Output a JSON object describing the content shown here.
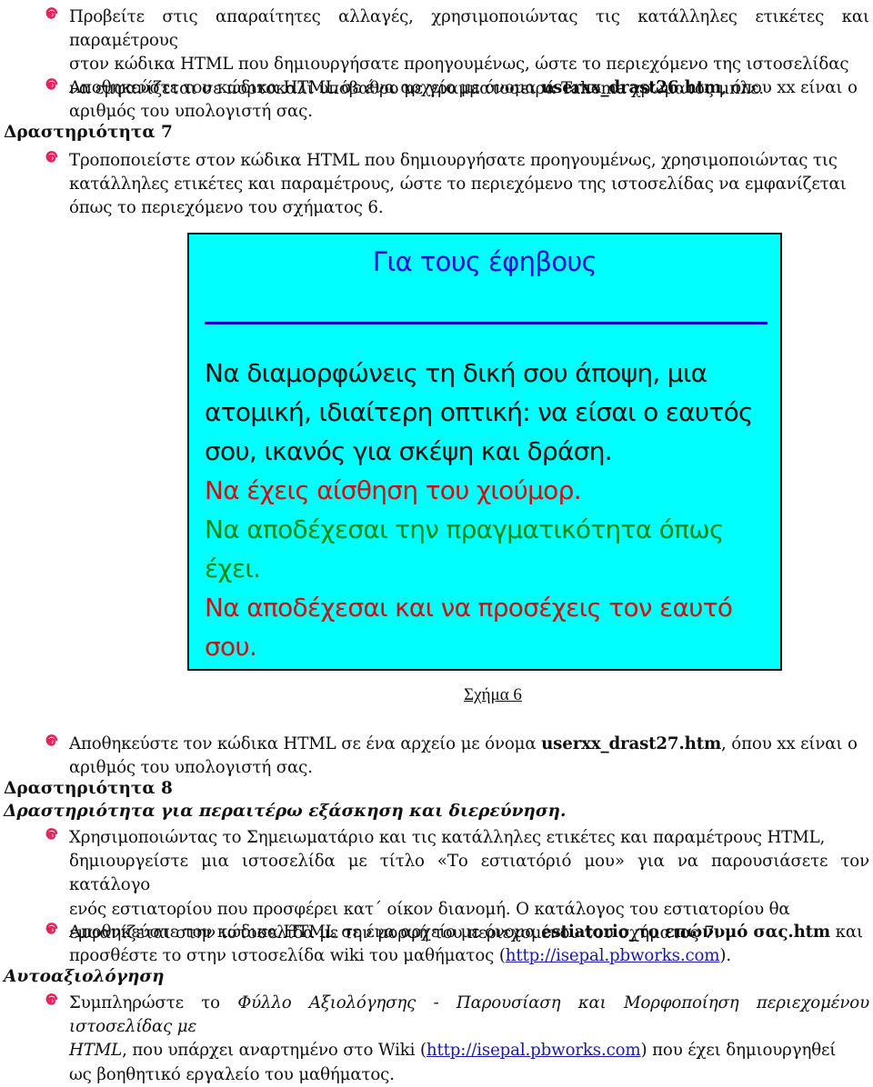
{
  "colors": {
    "bullet": "#e0245e",
    "figure_background": "#00ffff",
    "figure_title": "#1010d0",
    "figure_rule": "#0000cc",
    "figure_text_black": "#111111",
    "figure_text_red": "#cc1111",
    "figure_text_green": "#118811",
    "link": "#1a1aa6"
  },
  "bullet_icon": "spiral-bullet-icon",
  "section_6_tail": {
    "item1": {
      "line1": "Προβείτε στις απαραίτητες αλλαγές, χρησιμοποιώντας τις κατάλληλες ετικέτες και παραμέτρους",
      "line2": "στον κώδικα HTML που δημιουργήσατε προηγουμένως, ώστε το περιεχόμενο της ιστοσελίδας",
      "line3": "να εμφανίζεται σε πορτοκαλί υπόβαθρο με γραμματοσειρά Tahoma χρώματος μπλε."
    },
    "item2": {
      "prefix": "Αποθηκεύστε τον κώδικα HTML σε ένα αρχείο με όνομα ",
      "filename": "userxx_drast26.htm",
      "suffix": ", όπου xx  είναι ο",
      "line2": "αριθμός του υπολογιστή σας."
    }
  },
  "activity_7": {
    "heading": "Δραστηριότητα 7",
    "item1": {
      "line1": "Τροποποιείστε στον κώδικα HTML που δημιουργήσατε προηγουμένως, χρησιμοποιώντας τις",
      "line2": "κατάλληλες ετικέτες και παραμέτρους, ώστε το περιεχόμενο της ιστοσελίδας να εμφανίζεται",
      "line3": "όπως το περιεχόμενο του σχήματος 6."
    },
    "figure": {
      "title": "Για τους έφηβους",
      "lines": [
        {
          "text": "Να διαμορφώνεις τη δική σου άποψη, μια",
          "color": "black"
        },
        {
          "text": "ατομική, ιδιαίτερη οπτική: να είσαι ο εαυτός",
          "color": "black"
        },
        {
          "text": "σου, ικανός για σκέψη και δράση.",
          "color": "black"
        },
        {
          "text": "Να έχεις αίσθηση του χιούμορ.",
          "color": "red"
        },
        {
          "text": "Να αποδέχεσαι την πραγματικότητα όπως",
          "color": "green"
        },
        {
          "text": "έχει.",
          "color": "green"
        },
        {
          "text": "Να αποδέχεσαι και να προσέχεις τον εαυτό",
          "color": "red"
        },
        {
          "text": "σου.",
          "color": "red"
        }
      ],
      "caption": "Σχήμα 6"
    },
    "item2": {
      "prefix": "Αποθηκεύστε τον κώδικα  HTML σε ένα αρχείο με όνομα ",
      "filename": "userxx_drast27.htm",
      "suffix": ", όπου xx  είναι ο",
      "line2": "αριθμός του υπολογιστή σας."
    }
  },
  "activity_8": {
    "heading": "Δραστηριότητα 8",
    "subheading": "Δραστηριότητα για περαιτέρω εξάσκηση και διερεύνηση.",
    "item1": {
      "line1": "Χρησιμοποιώντας το Σημειωματάριο και τις κατάλληλες ετικέτες και παραμέτρους HTML,",
      "line2": "δημιουργείστε μια ιστοσελίδα με τίτλο «Το εστιατόριό μου» για να παρουσιάσετε τον κατάλογο",
      "line3": "ενός εστιατορίου που προσφέρει κατ΄ οίκον διανομή.  Ο κατάλογος του εστιατορίου θα",
      "line4": "εμφανίζεται στην ιστοσελίδα με την μορφή του περιεχομένου του σχήματος 7."
    },
    "item2": {
      "prefix": "Αποθηκεύστε τον κώδικα HTML σε ένα αρχείο με όνομα ",
      "filename": "estiatorio_το επώνυμό σας.htm",
      "suffix": " και",
      "line2_prefix": "προσθέστε το στην ιστοσελίδα wiki του μαθήματος (",
      "link": "http://isepal.pbworks.com",
      "line2_suffix": ")."
    }
  },
  "self_assessment": {
    "heading": "Αυτοαξιολόγηση",
    "item1": {
      "line1_prefix": "Συμπληρώστε το ",
      "line1_italic": "Φύλλο Αξιολόγησης - Παρουσίαση και Μορφοποίηση περιεχομένου ιστοσελίδας με",
      "line2_italic": "HTML",
      "line2_middle": ", που υπάρχει αναρτημένο στο Wiki (",
      "link": "http://isepal.pbworks.com",
      "line2_suffix": ") που έχει δημιουργηθεί",
      "line3": "ως βοηθητικό εργαλείο του μαθήματος."
    }
  }
}
